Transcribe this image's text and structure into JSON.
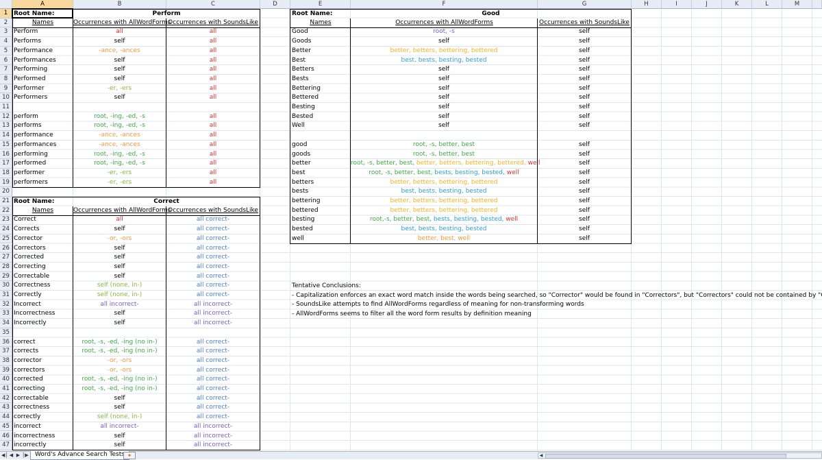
{
  "colors": {
    "red": "#d9312a",
    "green": "#3caa46",
    "orange": "#f29a3c",
    "yellow": "#f5b324",
    "blue": "#2ba0d8",
    "purple": "#7a5bc4",
    "lightgreen": "#8ab83a",
    "corblue": "#4a7fd0"
  },
  "columns": [
    "A",
    "B",
    "C",
    "D",
    "E",
    "F",
    "G",
    "H",
    "I",
    "J",
    "K",
    "L",
    "M"
  ],
  "rows": [
    "1",
    "2",
    "3",
    "4",
    "5",
    "6",
    "7",
    "8",
    "9",
    "10",
    "11",
    "12",
    "13",
    "14",
    "15",
    "16",
    "17",
    "18",
    "19",
    "20",
    "21",
    "22",
    "23",
    "24",
    "25",
    "26",
    "27",
    "28",
    "29",
    "30",
    "31",
    "32",
    "33",
    "34",
    "35",
    "36",
    "37",
    "38",
    "39",
    "40",
    "41",
    "42",
    "43",
    "44",
    "45",
    "46",
    "47"
  ],
  "perform": {
    "root_label": "Root Name:",
    "title": "Perform",
    "col_names": "Names",
    "col_awf": "Occurrences with AllWordForms",
    "col_sl": "Occurrences with SoundsLike",
    "rows": [
      {
        "r": 3,
        "name": "Perform",
        "awf": "all",
        "awf_c": "red",
        "sl": "all",
        "sl_c": "red"
      },
      {
        "r": 4,
        "name": "Performs",
        "awf": "self",
        "awf_c": "black",
        "sl": "all",
        "sl_c": "red"
      },
      {
        "r": 5,
        "name": "Performance",
        "awf": "-ance, -ances",
        "awf_c": "orange",
        "sl": "all",
        "sl_c": "red"
      },
      {
        "r": 6,
        "name": "Performances",
        "awf": "self",
        "awf_c": "black",
        "sl": "all",
        "sl_c": "red"
      },
      {
        "r": 7,
        "name": "Performing",
        "awf": "self",
        "awf_c": "black",
        "sl": "all",
        "sl_c": "red"
      },
      {
        "r": 8,
        "name": "Performed",
        "awf": "self",
        "awf_c": "black",
        "sl": "all",
        "sl_c": "red"
      },
      {
        "r": 9,
        "name": "Performer",
        "awf": "-er, -ers",
        "awf_c": "lightgreen",
        "sl": "all",
        "sl_c": "red"
      },
      {
        "r": 10,
        "name": "Performers",
        "awf": "self",
        "awf_c": "black",
        "sl": "all",
        "sl_c": "red"
      },
      {
        "r": 12,
        "name": "perform",
        "awf": "root, -ing, -ed, -s",
        "awf_c": "green",
        "sl": "all",
        "sl_c": "red"
      },
      {
        "r": 13,
        "name": "performs",
        "awf": "root, -ing, -ed, -s",
        "awf_c": "green",
        "sl": "all",
        "sl_c": "red"
      },
      {
        "r": 14,
        "name": "performance",
        "awf": "-ance, -ances",
        "awf_c": "orange",
        "sl": "all",
        "sl_c": "red"
      },
      {
        "r": 15,
        "name": "performances",
        "awf": "-ance, -ances",
        "awf_c": "orange",
        "sl": "all",
        "sl_c": "red"
      },
      {
        "r": 16,
        "name": "performing",
        "awf": "root, -ing, -ed, -s",
        "awf_c": "green",
        "sl": "all",
        "sl_c": "red"
      },
      {
        "r": 17,
        "name": "performed",
        "awf": "root, -ing, -ed, -s",
        "awf_c": "green",
        "sl": "all",
        "sl_c": "red"
      },
      {
        "r": 18,
        "name": "performer",
        "awf": "-er, -ers",
        "awf_c": "lightgreen",
        "sl": "all",
        "sl_c": "red"
      },
      {
        "r": 19,
        "name": "performers",
        "awf": "-er, -ers",
        "awf_c": "lightgreen",
        "sl": "all",
        "sl_c": "red"
      }
    ]
  },
  "correct": {
    "root_label": "Root Name:",
    "title": "Correct",
    "col_names": "Names",
    "col_awf": "Occurrences with AllWordForms",
    "col_sl": "Occurrences with SoundsLike",
    "rows": [
      {
        "r": 23,
        "name": "Correct",
        "awf": "all",
        "awf_c": "red",
        "sl": "all correct-",
        "sl_c": "corblue"
      },
      {
        "r": 24,
        "name": "Corrects",
        "awf": "self",
        "awf_c": "black",
        "sl": "all correct-",
        "sl_c": "corblue"
      },
      {
        "r": 25,
        "name": "Corrector",
        "awf": "-or, -ors",
        "awf_c": "orange",
        "sl": "all correct-",
        "sl_c": "corblue"
      },
      {
        "r": 26,
        "name": "Correctors",
        "awf": "self",
        "awf_c": "black",
        "sl": "all correct-",
        "sl_c": "corblue"
      },
      {
        "r": 27,
        "name": "Corrected",
        "awf": "self",
        "awf_c": "black",
        "sl": "all correct-",
        "sl_c": "corblue"
      },
      {
        "r": 28,
        "name": "Correcting",
        "awf": "self",
        "awf_c": "black",
        "sl": "all correct-",
        "sl_c": "corblue"
      },
      {
        "r": 29,
        "name": "Correctable",
        "awf": "self",
        "awf_c": "black",
        "sl": "all correct-",
        "sl_c": "corblue"
      },
      {
        "r": 30,
        "name": "Correctness",
        "awf": "self (none, in-)",
        "awf_c": "lightgreen",
        "sl": "all correct-",
        "sl_c": "corblue"
      },
      {
        "r": 31,
        "name": "Correctly",
        "awf": "self (none, in-)",
        "awf_c": "lightgreen",
        "sl": "all correct-",
        "sl_c": "corblue"
      },
      {
        "r": 32,
        "name": "Incorrect",
        "awf": "all incorrect-",
        "awf_c": "purple",
        "sl": "all incorrect-",
        "sl_c": "purple"
      },
      {
        "r": 33,
        "name": "Incorrectness",
        "awf": "self",
        "awf_c": "black",
        "sl": "all incorrect-",
        "sl_c": "purple"
      },
      {
        "r": 34,
        "name": "Incorrectly",
        "awf": "self",
        "awf_c": "black",
        "sl": "all incorrect-",
        "sl_c": "purple"
      },
      {
        "r": 36,
        "name": "correct",
        "awf": "root, -s, -ed, -ing (no in-)",
        "awf_c": "green",
        "sl": "all correct-",
        "sl_c": "corblue"
      },
      {
        "r": 37,
        "name": "corrects",
        "awf": "root, -s, -ed, -ing (no in-)",
        "awf_c": "green",
        "sl": "all correct-",
        "sl_c": "corblue"
      },
      {
        "r": 38,
        "name": "corrector",
        "awf": "-or, -ors",
        "awf_c": "orange",
        "sl": "all correct-",
        "sl_c": "corblue"
      },
      {
        "r": 39,
        "name": "correctors",
        "awf": "-or, -ors",
        "awf_c": "orange",
        "sl": "all correct-",
        "sl_c": "corblue"
      },
      {
        "r": 40,
        "name": "corrected",
        "awf": "root, -s, -ed, -ing (no in-)",
        "awf_c": "green",
        "sl": "all correct-",
        "sl_c": "corblue"
      },
      {
        "r": 41,
        "name": "correcting",
        "awf": "root, -s, -ed, -ing (no in-)",
        "awf_c": "green",
        "sl": "all correct-",
        "sl_c": "corblue"
      },
      {
        "r": 42,
        "name": "correctable",
        "awf": "self",
        "awf_c": "black",
        "sl": "all correct-",
        "sl_c": "corblue"
      },
      {
        "r": 43,
        "name": "correctness",
        "awf": "self",
        "awf_c": "black",
        "sl": "all correct-",
        "sl_c": "corblue"
      },
      {
        "r": 44,
        "name": "correctly",
        "awf": "self (none, in-)",
        "awf_c": "lightgreen",
        "sl": "all correct-",
        "sl_c": "corblue"
      },
      {
        "r": 45,
        "name": "incorrect",
        "awf": "all incorrect-",
        "awf_c": "purple",
        "sl": "all incorrect-",
        "sl_c": "purple"
      },
      {
        "r": 46,
        "name": "incorrectness",
        "awf": "self",
        "awf_c": "black",
        "sl": "all incorrect-",
        "sl_c": "purple"
      },
      {
        "r": 47,
        "name": "incorrectly",
        "awf": "self",
        "awf_c": "black",
        "sl": "all incorrect-",
        "sl_c": "purple"
      }
    ]
  },
  "good": {
    "root_label": "Root Name:",
    "title": "Good",
    "col_names": "Names",
    "col_awf": "Occurrences with AllWordForms",
    "col_sl": "Occurrences with SoundsLike",
    "rows": [
      {
        "r": 3,
        "name": "Good",
        "awf": [
          [
            "root, -s",
            "purple"
          ]
        ],
        "sl": "self"
      },
      {
        "r": 4,
        "name": "Goods",
        "awf": [
          [
            "self",
            "black"
          ]
        ],
        "sl": "self"
      },
      {
        "r": 5,
        "name": "Better",
        "awf": [
          [
            "better, betters, bettering, bettered",
            "yellow"
          ]
        ],
        "sl": "self"
      },
      {
        "r": 6,
        "name": "Best",
        "awf": [
          [
            "best, bests, besting, bested",
            "blue"
          ]
        ],
        "sl": "self"
      },
      {
        "r": 7,
        "name": "Betters",
        "awf": [
          [
            "self",
            "black"
          ]
        ],
        "sl": "self"
      },
      {
        "r": 8,
        "name": "Bests",
        "awf": [
          [
            "self",
            "black"
          ]
        ],
        "sl": "self"
      },
      {
        "r": 9,
        "name": "Bettering",
        "awf": [
          [
            "self",
            "black"
          ]
        ],
        "sl": "self"
      },
      {
        "r": 10,
        "name": "Bettered",
        "awf": [
          [
            "self",
            "black"
          ]
        ],
        "sl": "self"
      },
      {
        "r": 11,
        "name": "Besting",
        "awf": [
          [
            "self",
            "black"
          ]
        ],
        "sl": "self"
      },
      {
        "r": 12,
        "name": "Bested",
        "awf": [
          [
            "self",
            "black"
          ]
        ],
        "sl": "self"
      },
      {
        "r": 13,
        "name": "Well",
        "awf": [
          [
            "self",
            "black"
          ]
        ],
        "sl": "self"
      },
      {
        "r": 15,
        "name": "good",
        "awf": [
          [
            "root, -s, better, best",
            "green"
          ]
        ],
        "sl": "self"
      },
      {
        "r": 16,
        "name": "goods",
        "awf": [
          [
            "root, -s, better, best",
            "green"
          ]
        ],
        "sl": "self"
      },
      {
        "r": 17,
        "name": "better",
        "awf": [
          [
            "root, -s, better, best, ",
            "green"
          ],
          [
            "better, betters, bettering, bettered, ",
            "yellow"
          ],
          [
            "well",
            "red"
          ]
        ],
        "sl": "self"
      },
      {
        "r": 18,
        "name": "best",
        "awf": [
          [
            "root, -s, better, best, ",
            "green"
          ],
          [
            "bests, besting, bested, ",
            "blue"
          ],
          [
            "well",
            "red"
          ]
        ],
        "sl": "self"
      },
      {
        "r": 19,
        "name": "betters",
        "awf": [
          [
            "better, betters, bettering, bettered",
            "yellow"
          ]
        ],
        "sl": "self"
      },
      {
        "r": 20,
        "name": "bests",
        "awf": [
          [
            "best, bests, besting, bested",
            "blue"
          ]
        ],
        "sl": "self"
      },
      {
        "r": 21,
        "name": "bettering",
        "awf": [
          [
            "better, betters, bettering, bettered",
            "yellow"
          ]
        ],
        "sl": "self"
      },
      {
        "r": 22,
        "name": "bettered",
        "awf": [
          [
            "better, betters, bettering, bettered",
            "yellow"
          ]
        ],
        "sl": "self"
      },
      {
        "r": 23,
        "name": "besting",
        "awf": [
          [
            "root,-s, better, best, ",
            "green"
          ],
          [
            "bests, besting, bested, ",
            "blue"
          ],
          [
            "well",
            "red"
          ]
        ],
        "sl": "self"
      },
      {
        "r": 24,
        "name": "bested",
        "awf": [
          [
            "best, bests, besting, bested",
            "blue"
          ]
        ],
        "sl": "self"
      },
      {
        "r": 25,
        "name": "well",
        "awf": [
          [
            "better, best, well",
            "orange"
          ]
        ],
        "sl": "self"
      }
    ]
  },
  "conclusions": {
    "title": "Tentative Conclusions:",
    "lines": [
      "- Capitalization enforces an exact word match inside the words being searched, so \"Corrector\" would be found in \"Correctors\", but \"Correctors\" could not be contained by \"Corrector\"",
      "- SoundsLike attempts to find AllWordForms regardless of meaning for non-transforming words",
      "- AllWordForms seems to filter all the word form results by definition meaning"
    ]
  },
  "sheet_tab": {
    "label": "Word's Advance Search Tests"
  },
  "icons": {
    "first": "first-sheet-icon",
    "prev": "prev-sheet-icon",
    "next": "next-sheet-icon",
    "last": "last-sheet-icon",
    "new": "insert-sheet-icon"
  }
}
